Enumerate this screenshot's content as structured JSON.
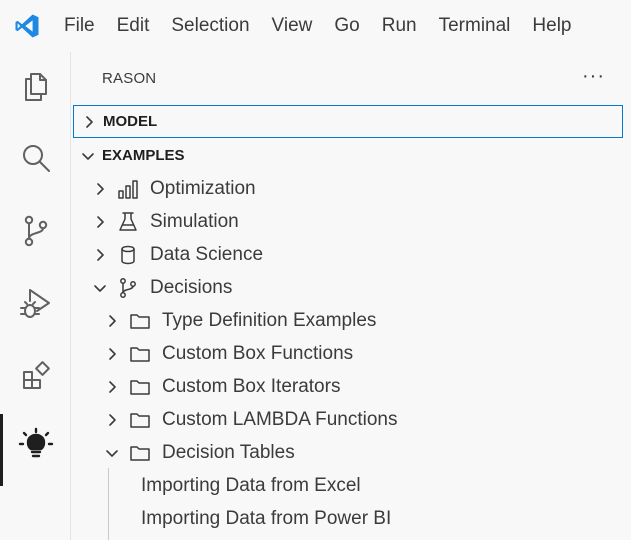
{
  "menu": {
    "items": [
      "File",
      "Edit",
      "Selection",
      "View",
      "Go",
      "Run",
      "Terminal",
      "Help"
    ]
  },
  "activity_bar": [
    {
      "name": "explorer",
      "icon": "files-icon"
    },
    {
      "name": "search",
      "icon": "search-icon"
    },
    {
      "name": "source-control",
      "icon": "source-control-icon"
    },
    {
      "name": "run-debug",
      "icon": "run-debug-icon"
    },
    {
      "name": "extensions",
      "icon": "extensions-icon"
    },
    {
      "name": "rason",
      "icon": "lightbulb-icon",
      "active": true
    }
  ],
  "sidebar": {
    "title": "RASON",
    "more_label": "···",
    "sections": [
      {
        "label": "MODEL",
        "expanded": false
      },
      {
        "label": "EXAMPLES",
        "expanded": true
      }
    ],
    "examples": [
      {
        "label": "Optimization",
        "icon": "bar-chart-icon",
        "expanded": false
      },
      {
        "label": "Simulation",
        "icon": "flask-icon",
        "expanded": false
      },
      {
        "label": "Data Science",
        "icon": "database-icon",
        "expanded": false
      },
      {
        "label": "Decisions",
        "icon": "branch-icon",
        "expanded": true
      }
    ],
    "decisions": [
      {
        "label": "Type Definition Examples",
        "expanded": false
      },
      {
        "label": "Custom Box Functions",
        "expanded": false
      },
      {
        "label": "Custom Box Iterators",
        "expanded": false
      },
      {
        "label": "Custom LAMBDA Functions",
        "expanded": false
      },
      {
        "label": "Decision Tables",
        "expanded": true
      }
    ],
    "decision_tables": [
      {
        "label": "Importing Data from Excel"
      },
      {
        "label": "Importing Data from Power BI"
      }
    ]
  },
  "colors": {
    "accent": "#0078d4",
    "logo": "#1e88e5",
    "background": "#f8f8f8"
  }
}
